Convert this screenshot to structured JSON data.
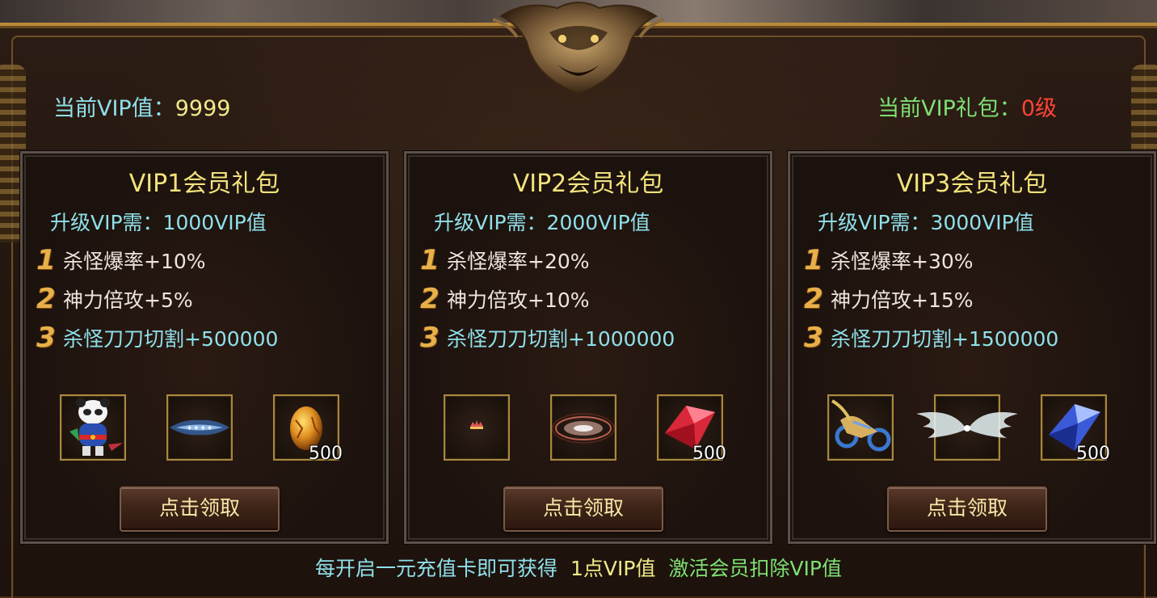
{
  "stats": {
    "current_vip_label": "当前VIP值：",
    "current_vip_value": "9999",
    "current_pack_label": "当前VIP礼包：",
    "current_pack_value": "0级"
  },
  "packs": [
    {
      "title": "VIP1会员礼包",
      "requirement": "升级VIP需：1000VIP值",
      "benefits": [
        {
          "num": "1",
          "text": "杀怪爆率+10%"
        },
        {
          "num": "2",
          "text": "神力倍攻+5%"
        },
        {
          "num": "3",
          "text": "杀怪刀刀切割+500000"
        }
      ],
      "items": [
        {
          "icon": "panda-pet-icon",
          "qty": ""
        },
        {
          "icon": "title-badge-icon",
          "qty": ""
        },
        {
          "icon": "golden-egg-icon",
          "qty": "500"
        }
      ],
      "claim_label": "点击领取"
    },
    {
      "title": "VIP2会员礼包",
      "requirement": "升级VIP需：2000VIP值",
      "benefits": [
        {
          "num": "1",
          "text": "杀怪爆率+20%"
        },
        {
          "num": "2",
          "text": "神力倍攻+10%"
        },
        {
          "num": "3",
          "text": "杀怪刀刀切割+1000000"
        }
      ],
      "items": [
        {
          "icon": "small-crown-icon",
          "qty": ""
        },
        {
          "icon": "magic-aura-icon",
          "qty": ""
        },
        {
          "icon": "red-gem-icon",
          "qty": "500"
        }
      ],
      "claim_label": "点击领取"
    },
    {
      "title": "VIP3会员礼包",
      "requirement": "升级VIP需：3000VIP值",
      "benefits": [
        {
          "num": "1",
          "text": "杀怪爆率+30%"
        },
        {
          "num": "2",
          "text": "神力倍攻+15%"
        },
        {
          "num": "3",
          "text": "杀怪刀刀切割+1500000"
        }
      ],
      "items": [
        {
          "icon": "motorcycle-mount-icon",
          "qty": ""
        },
        {
          "icon": "angel-wings-icon",
          "qty": ""
        },
        {
          "icon": "blue-gem-icon",
          "qty": "500"
        }
      ],
      "claim_label": "点击领取"
    }
  ],
  "footer": {
    "part1": "每开启一元充值卡即可获得",
    "part2": "1点VIP值",
    "part3": "激活会员扣除VIP值"
  },
  "colors": {
    "cyan_text": "#8fe0ea",
    "yellow_text": "#f0ea8a",
    "green_text": "#7ee073",
    "red_text": "#ff4436",
    "gold_border": "#a9883f"
  }
}
